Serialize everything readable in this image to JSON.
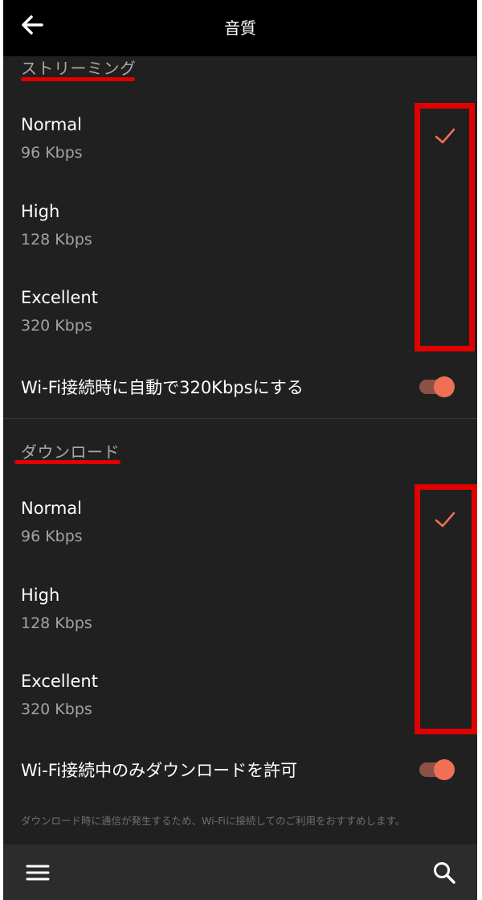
{
  "header": {
    "title": "音質"
  },
  "streaming": {
    "section_title": "ストリーミング",
    "options": [
      {
        "name": "Normal",
        "bitrate": "96 Kbps",
        "selected": true
      },
      {
        "name": "High",
        "bitrate": "128 Kbps",
        "selected": false
      },
      {
        "name": "Excellent",
        "bitrate": "320 Kbps",
        "selected": false
      }
    ],
    "auto_wifi": {
      "label": "Wi-Fi接続時に自動で320Kbpsにする",
      "enabled": true
    }
  },
  "download": {
    "section_title": "ダウンロード",
    "options": [
      {
        "name": "Normal",
        "bitrate": "96 Kbps",
        "selected": true
      },
      {
        "name": "High",
        "bitrate": "128 Kbps",
        "selected": false
      },
      {
        "name": "Excellent",
        "bitrate": "320 Kbps",
        "selected": false
      }
    ],
    "wifi_only": {
      "label": "Wi-Fi接続中のみダウンロードを許可",
      "enabled": true
    },
    "note": "ダウンロード時に通信が発生するため、Wi-Fiに接続してのご利用をおすすめします。"
  },
  "colors": {
    "accent": "#f07055",
    "annotation_red": "#e00000",
    "background": "#202020"
  },
  "icons": {
    "back": "arrow-left-icon",
    "check": "check-icon",
    "menu": "hamburger-menu-icon",
    "search": "search-icon"
  }
}
